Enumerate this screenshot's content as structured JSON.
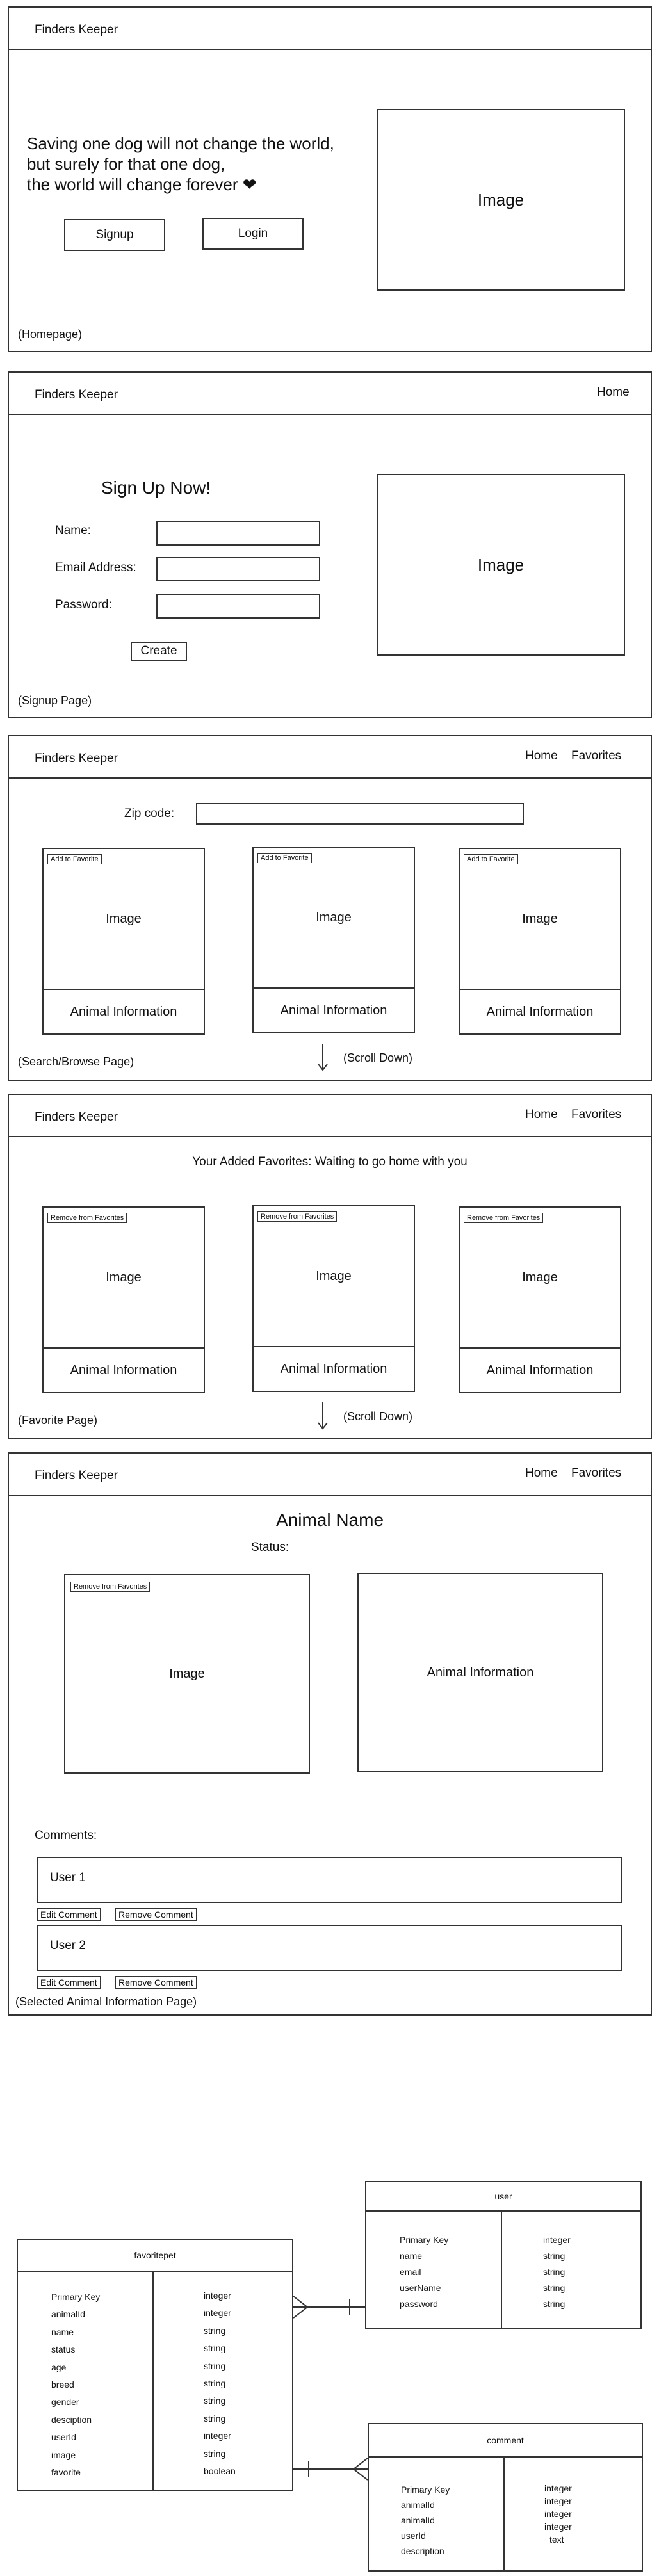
{
  "homepage": {
    "brand": "Finders Keeper",
    "quote_line1": "Saving one dog will not change the world,",
    "quote_line2": "but surely for that one dog,",
    "quote_line3": "the world will change forever",
    "heart": "❤",
    "signup_label": "Signup",
    "login_label": "Login",
    "image_label": "Image",
    "caption": "(Homepage)"
  },
  "signup": {
    "brand": "Finders Keeper",
    "nav_home": "Home",
    "heading": "Sign Up Now!",
    "name_label": "Name:",
    "email_label": "Email Address:",
    "password_label": "Password:",
    "create_label": "Create",
    "image_label": "Image",
    "caption": "(Signup Page)"
  },
  "search": {
    "brand": "Finders Keeper",
    "nav_home": "Home",
    "nav_favorites": "Favorites",
    "zip_label": "Zip code:",
    "cards": [
      {
        "button": "Add to Favorite",
        "image": "Image",
        "info": "Animal Information"
      },
      {
        "button": "Add to Favorite",
        "image": "Image",
        "info": "Animal Information"
      },
      {
        "button": "Add to Favorite",
        "image": "Image",
        "info": "Animal Information"
      }
    ],
    "scroll_label": "(Scroll Down)",
    "caption": "(Search/Browse Page)"
  },
  "favorites": {
    "brand": "Finders Keeper",
    "nav_home": "Home",
    "nav_favorites": "Favorites",
    "heading": "Your Added Favorites: Waiting to go home with you",
    "cards": [
      {
        "button": "Remove from Favorites",
        "image": "Image",
        "info": "Animal Information"
      },
      {
        "button": "Remove from Favorites",
        "image": "Image",
        "info": "Animal Information"
      },
      {
        "button": "Remove from Favorites",
        "image": "Image",
        "info": "Animal Information"
      }
    ],
    "scroll_label": "(Scroll Down)",
    "caption": "(Favorite Page)"
  },
  "detail": {
    "brand": "Finders Keeper",
    "nav_home": "Home",
    "nav_favorites": "Favorites",
    "animal_name": "Animal Name",
    "status_label": "Status:",
    "remove_button": "Remove from Favorites",
    "image_label": "Image",
    "info_label": "Animal Information",
    "comments_label": "Comments:",
    "comments": [
      {
        "user": "User 1",
        "edit": "Edit Comment",
        "remove": "Remove Comment"
      },
      {
        "user": "User 2",
        "edit": "Edit Comment",
        "remove": "Remove Comment"
      }
    ],
    "caption": "(Selected Animal Information Page)"
  },
  "er": {
    "favoritepet": {
      "title": "favoritepet",
      "fields": [
        "Primary Key",
        "animalId",
        "name",
        "status",
        "age",
        "breed",
        "gender",
        "desciption",
        "userId",
        "image",
        "favorite"
      ],
      "types": [
        "integer",
        "integer",
        "string",
        "string",
        "string",
        "string",
        "string",
        "string",
        "integer",
        "string",
        "boolean"
      ]
    },
    "user": {
      "title": "user",
      "fields": [
        "Primary Key",
        "name",
        "email",
        "userName",
        "password"
      ],
      "types": [
        "integer",
        "string",
        "string",
        "string",
        "string"
      ]
    },
    "comment": {
      "title": "comment",
      "fields": [
        "Primary Key",
        "animalId",
        "animalId",
        "userId",
        "description"
      ],
      "types": [
        "integer",
        "integer",
        "integer",
        "integer",
        "text"
      ]
    }
  }
}
